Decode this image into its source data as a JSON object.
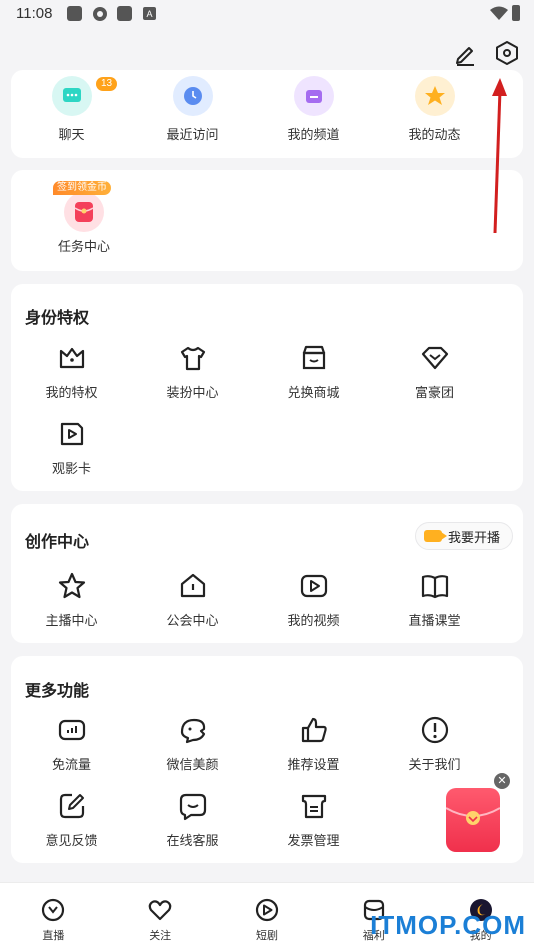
{
  "status": {
    "time": "11:08"
  },
  "quick": {
    "items": [
      {
        "label": "聊天"
      },
      {
        "label": "最近访问"
      },
      {
        "label": "我的频道"
      },
      {
        "label": "我的动态"
      }
    ],
    "chat_badge": "13"
  },
  "task": {
    "badge": "签到领金币",
    "label": "任务中心"
  },
  "identity": {
    "title": "身份特权",
    "items": [
      {
        "label": "我的特权"
      },
      {
        "label": "装扮中心"
      },
      {
        "label": "兑换商城"
      },
      {
        "label": "富豪团"
      },
      {
        "label": "观影卡"
      }
    ]
  },
  "creation": {
    "title": "创作中心",
    "live_button": "我要开播",
    "items": [
      {
        "label": "主播中心"
      },
      {
        "label": "公会中心"
      },
      {
        "label": "我的视频"
      },
      {
        "label": "直播课堂"
      }
    ]
  },
  "more": {
    "title": "更多功能",
    "items": [
      {
        "label": "免流量"
      },
      {
        "label": "微信美颜"
      },
      {
        "label": "推荐设置"
      },
      {
        "label": "关于我们"
      },
      {
        "label": "意见反馈"
      },
      {
        "label": "在线客服"
      },
      {
        "label": "发票管理"
      }
    ]
  },
  "nav": {
    "items": [
      {
        "label": "直播"
      },
      {
        "label": "关注"
      },
      {
        "label": "短剧"
      },
      {
        "label": "福利"
      },
      {
        "label": "我的"
      }
    ]
  },
  "watermark": "ITMOP.COM",
  "colors": {
    "accent": "#ffa21a",
    "arrow": "#d21f1f",
    "watermark": "#1b7fd6"
  }
}
